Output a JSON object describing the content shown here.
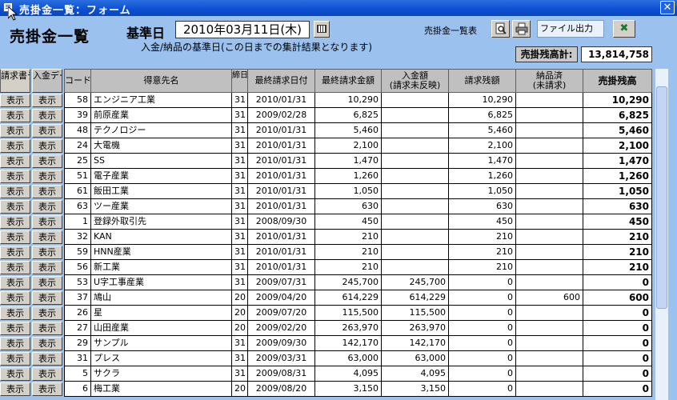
{
  "window": {
    "title": "売掛金一覧：フォーム"
  },
  "header": {
    "page_title": "売掛金一覧",
    "date_label": "基準日",
    "date_value": "2010年03月11日(木)",
    "note": "入金/納品の基準日(この日までの集計結果となります)",
    "list_label": "売掛金一覧表",
    "file_output": "ファイル出力",
    "total_label": "売掛残高計:",
    "total_value": "13,814,758"
  },
  "icons": {
    "preview": "print-preview-icon",
    "printer": "printer-icon",
    "excel": "excel-icon",
    "calendar": "calendar-icon",
    "close": "close-icon"
  },
  "columns": {
    "invoice_data": "請求書データ",
    "payment_data": "入金データ",
    "code": "コード",
    "customer": "得意先名",
    "closing": "締日",
    "last_invoice_date": "最終請求日付",
    "last_invoice_amount": "最終請求金額",
    "payment_amount_l1": "入金額",
    "payment_amount_l2": "(請求未反映)",
    "invoice_balance": "請求残額",
    "delivered_l1": "納品済",
    "delivered_l2": "(未請求)",
    "balance": "売掛残高"
  },
  "button_label": "表示",
  "rows": [
    {
      "code": "58",
      "name": "エンジニア工業",
      "close": "31",
      "date": "2010/01/31",
      "amount": "10,290",
      "paid": "",
      "remain": "10,290",
      "deliv": "",
      "balance": "10,290"
    },
    {
      "code": "39",
      "name": "前原産業",
      "close": "31",
      "date": "2009/02/28",
      "amount": "6,825",
      "paid": "",
      "remain": "6,825",
      "deliv": "",
      "balance": "6,825"
    },
    {
      "code": "48",
      "name": "テクノロジー",
      "close": "31",
      "date": "2010/01/31",
      "amount": "5,460",
      "paid": "",
      "remain": "5,460",
      "deliv": "",
      "balance": "5,460"
    },
    {
      "code": "24",
      "name": "大電機",
      "close": "31",
      "date": "2010/01/31",
      "amount": "2,100",
      "paid": "",
      "remain": "2,100",
      "deliv": "",
      "balance": "2,100"
    },
    {
      "code": "25",
      "name": "SS",
      "close": "31",
      "date": "2010/01/31",
      "amount": "1,470",
      "paid": "",
      "remain": "1,470",
      "deliv": "",
      "balance": "1,470"
    },
    {
      "code": "51",
      "name": "電子産業",
      "close": "31",
      "date": "2010/01/31",
      "amount": "1,260",
      "paid": "",
      "remain": "1,260",
      "deliv": "",
      "balance": "1,260"
    },
    {
      "code": "61",
      "name": "飯田工業",
      "close": "31",
      "date": "2010/01/31",
      "amount": "1,050",
      "paid": "",
      "remain": "1,050",
      "deliv": "",
      "balance": "1,050"
    },
    {
      "code": "63",
      "name": "ツー産業",
      "close": "31",
      "date": "2010/01/31",
      "amount": "630",
      "paid": "",
      "remain": "630",
      "deliv": "",
      "balance": "630"
    },
    {
      "code": "1",
      "name": "登録外取引先",
      "close": "31",
      "date": "2008/09/30",
      "amount": "450",
      "paid": "",
      "remain": "450",
      "deliv": "",
      "balance": "450"
    },
    {
      "code": "32",
      "name": "KAN",
      "close": "31",
      "date": "2010/01/31",
      "amount": "210",
      "paid": "",
      "remain": "210",
      "deliv": "",
      "balance": "210"
    },
    {
      "code": "59",
      "name": "HNN産業",
      "close": "31",
      "date": "2010/01/31",
      "amount": "210",
      "paid": "",
      "remain": "210",
      "deliv": "",
      "balance": "210"
    },
    {
      "code": "56",
      "name": "新工業",
      "close": "31",
      "date": "2010/01/31",
      "amount": "210",
      "paid": "",
      "remain": "210",
      "deliv": "",
      "balance": "210"
    },
    {
      "code": "53",
      "name": "U字工事産業",
      "close": "31",
      "date": "2009/07/31",
      "amount": "245,700",
      "paid": "245,700",
      "remain": "0",
      "deliv": "",
      "balance": "0"
    },
    {
      "code": "37",
      "name": "鳩山",
      "close": "20",
      "date": "2009/04/20",
      "amount": "614,229",
      "paid": "614,229",
      "remain": "0",
      "deliv": "600",
      "balance": "600"
    },
    {
      "code": "26",
      "name": "星",
      "close": "20",
      "date": "2009/07/20",
      "amount": "115,500",
      "paid": "115,500",
      "remain": "0",
      "deliv": "",
      "balance": "0"
    },
    {
      "code": "27",
      "name": "山田産業",
      "close": "20",
      "date": "2009/02/20",
      "amount": "263,970",
      "paid": "263,970",
      "remain": "0",
      "deliv": "",
      "balance": "0"
    },
    {
      "code": "29",
      "name": "サンプル",
      "close": "31",
      "date": "2009/09/30",
      "amount": "142,170",
      "paid": "142,170",
      "remain": "0",
      "deliv": "",
      "balance": "0"
    },
    {
      "code": "31",
      "name": "プレス",
      "close": "31",
      "date": "2009/03/31",
      "amount": "63,000",
      "paid": "63,000",
      "remain": "0",
      "deliv": "",
      "balance": "0"
    },
    {
      "code": "5",
      "name": "サクラ",
      "close": "31",
      "date": "2009/08/31",
      "amount": "4,095",
      "paid": "4,095",
      "remain": "0",
      "deliv": "",
      "balance": "0"
    },
    {
      "code": "6",
      "name": "梅工業",
      "close": "20",
      "date": "2009/08/20",
      "amount": "3,150",
      "paid": "3,150",
      "remain": "0",
      "deliv": "",
      "balance": "0"
    }
  ]
}
